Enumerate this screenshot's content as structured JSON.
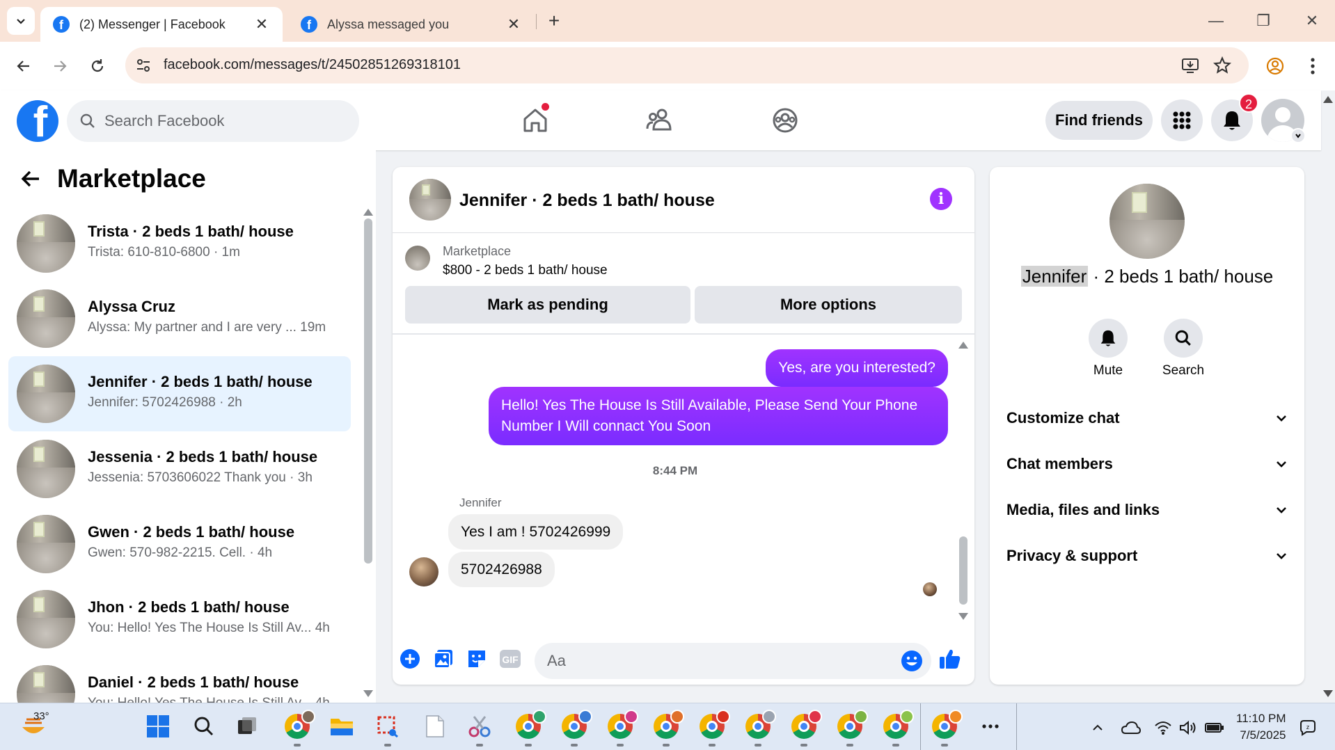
{
  "browser": {
    "tabs": [
      {
        "title": "(2) Messenger | Facebook",
        "active": true
      },
      {
        "title": "Alyssa messaged you",
        "active": false
      }
    ],
    "url": "facebook.com/messages/t/24502851269318101"
  },
  "fb_header": {
    "search_placeholder": "Search Facebook",
    "find_friends_label": "Find friends",
    "notification_count": "2"
  },
  "left_panel": {
    "title": "Marketplace",
    "conversations": [
      {
        "name": "Trista · 2 beds 1 bath/ house",
        "preview": "Trista: 610-810-6800 · 1m",
        "active": false
      },
      {
        "name": "Alyssa Cruz",
        "preview": "Alyssa: My partner and I are very ...  19m",
        "active": false
      },
      {
        "name": "Jennifer · 2 beds 1 bath/ house",
        "preview": "Jennifer: 5702426988 · 2h",
        "active": true
      },
      {
        "name": "Jessenia · 2 beds 1 bath/ house",
        "preview": "Jessenia: 5703606022 Thank you · 3h",
        "active": false
      },
      {
        "name": "Gwen · 2 beds 1 bath/ house",
        "preview": "Gwen: 570-982-2215. Cell. · 4h",
        "active": false
      },
      {
        "name": "Jhon · 2 beds 1 bath/ house",
        "preview": "You: Hello! Yes The House Is Still Av...  4h",
        "active": false
      },
      {
        "name": "Daniel · 2 beds 1 bath/ house",
        "preview": "You: Hello! Yes The House Is Still Av...  4h",
        "active": false
      }
    ]
  },
  "chat": {
    "title": "Jennifer · 2 beds 1 bath/ house",
    "marketplace_label": "Marketplace",
    "listing": "$800 - 2 beds 1 bath/ house",
    "mark_pending_label": "Mark as pending",
    "more_options_label": "More options",
    "messages_out": [
      "Yes, are you interested?",
      "Hello! Yes The House  Is Still Available, Please Send Your Phone Number I Will connact You Soon"
    ],
    "timestamp": "8:44 PM",
    "sender": "Jennifer",
    "messages_in": [
      "Yes I am ! 5702426999",
      "5702426988"
    ],
    "composer_placeholder": "Aa",
    "accent_color": "#a033ff"
  },
  "right_panel": {
    "name_highlight": "Jennifer",
    "name_rest": " · 2 beds 1 bath/ house",
    "actions": [
      {
        "label": "Mute",
        "icon": "bell-icon"
      },
      {
        "label": "Search",
        "icon": "search-icon"
      }
    ],
    "sections": [
      "Customize chat",
      "Chat members",
      "Media, files and links",
      "Privacy & support"
    ]
  },
  "taskbar": {
    "temperature": "33°",
    "time": "11:10 PM",
    "date": "7/5/2025"
  }
}
